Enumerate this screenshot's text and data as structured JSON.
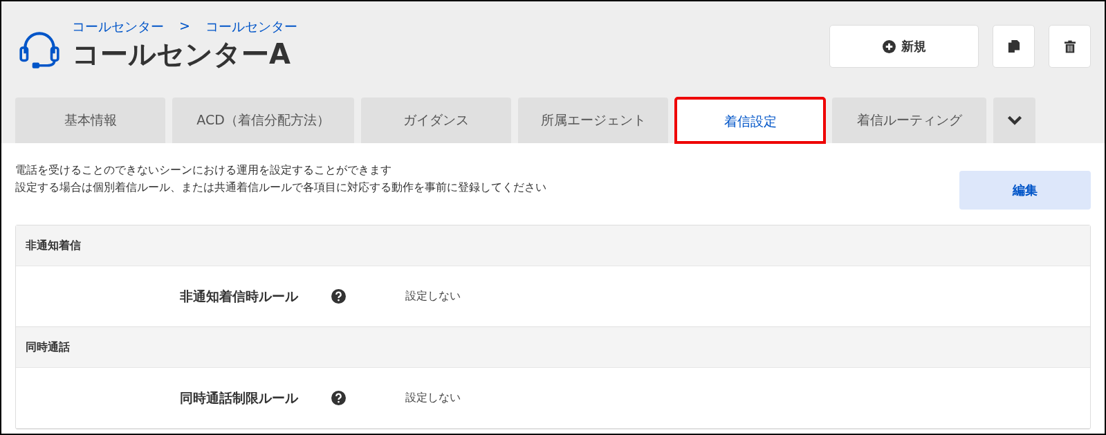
{
  "breadcrumb": [
    "コールセンター",
    "コールセンター"
  ],
  "breadcrumb_separator": ">",
  "title": "コールセンターA",
  "actions": {
    "new_label": "新規"
  },
  "tabs": [
    {
      "label": "基本情報",
      "selected": false
    },
    {
      "label": "ACD（着信分配方法）",
      "selected": false
    },
    {
      "label": "ガイダンス",
      "selected": false
    },
    {
      "label": "所属エージェント",
      "selected": false
    },
    {
      "label": "着信設定",
      "selected": true
    },
    {
      "label": "着信ルーティング",
      "selected": false
    }
  ],
  "description": [
    "電話を受けることのできないシーンにおける運用を設定することができます",
    "設定する場合は個別着信ルール、または共通着信ルールで各項目に対応する動作を事前に登録してください"
  ],
  "edit_button": "編集",
  "sections": [
    {
      "heading": "非通知着信",
      "rows": [
        {
          "label": "非通知着信時ルール",
          "value": "設定しない"
        }
      ]
    },
    {
      "heading": "同時通話",
      "rows": [
        {
          "label": "同時通話制限ルール",
          "value": "設定しない"
        }
      ]
    }
  ]
}
